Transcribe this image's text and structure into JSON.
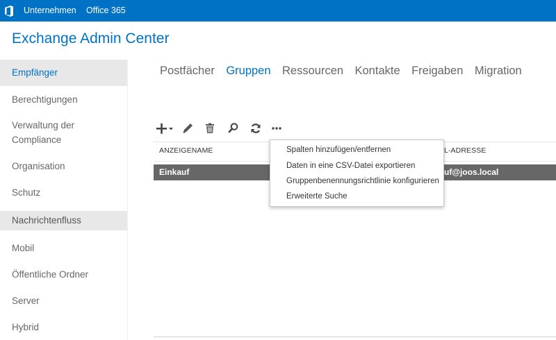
{
  "topbar": {
    "links": [
      {
        "label": "Unternehmen"
      },
      {
        "label": "Office 365"
      }
    ],
    "brand_color": "#0072c6"
  },
  "app": {
    "title": "Exchange Admin Center"
  },
  "sidebar": {
    "items": [
      {
        "label": "Empfänger",
        "state": "selected"
      },
      {
        "label": "Berechtigungen"
      },
      {
        "label": "Verwaltung der Compliance"
      },
      {
        "label": "Organisation"
      },
      {
        "label": "Schutz"
      },
      {
        "label": "Nachrichtenfluss",
        "state": "highlighted"
      },
      {
        "label": "Mobil"
      },
      {
        "label": "Öffentliche Ordner"
      },
      {
        "label": "Server"
      },
      {
        "label": "Hybrid"
      }
    ]
  },
  "tabs": [
    {
      "label": "Postfächer"
    },
    {
      "label": "Gruppen",
      "active": true
    },
    {
      "label": "Ressourcen"
    },
    {
      "label": "Kontakte"
    },
    {
      "label": "Freigaben"
    },
    {
      "label": "Migration"
    }
  ],
  "toolbar": {
    "buttons": [
      {
        "icon": "add-icon"
      },
      {
        "icon": "edit-icon"
      },
      {
        "icon": "delete-icon"
      },
      {
        "icon": "search-icon"
      },
      {
        "icon": "refresh-icon"
      },
      {
        "icon": "more-icon"
      }
    ]
  },
  "table": {
    "columns": [
      "ANZEIGENAME",
      "L-ADRESSE"
    ],
    "rows": [
      {
        "name": "Einkauf",
        "email": "uf@joos.local"
      }
    ]
  },
  "menu": {
    "items": [
      {
        "label": "Spalten hinzufügen/entfernen"
      },
      {
        "label": "Daten in eine CSV-Datei exportieren"
      },
      {
        "label": "Gruppenbenennungsrichtlinie konfigurieren"
      },
      {
        "label": "Erweiterte Suche"
      }
    ]
  }
}
